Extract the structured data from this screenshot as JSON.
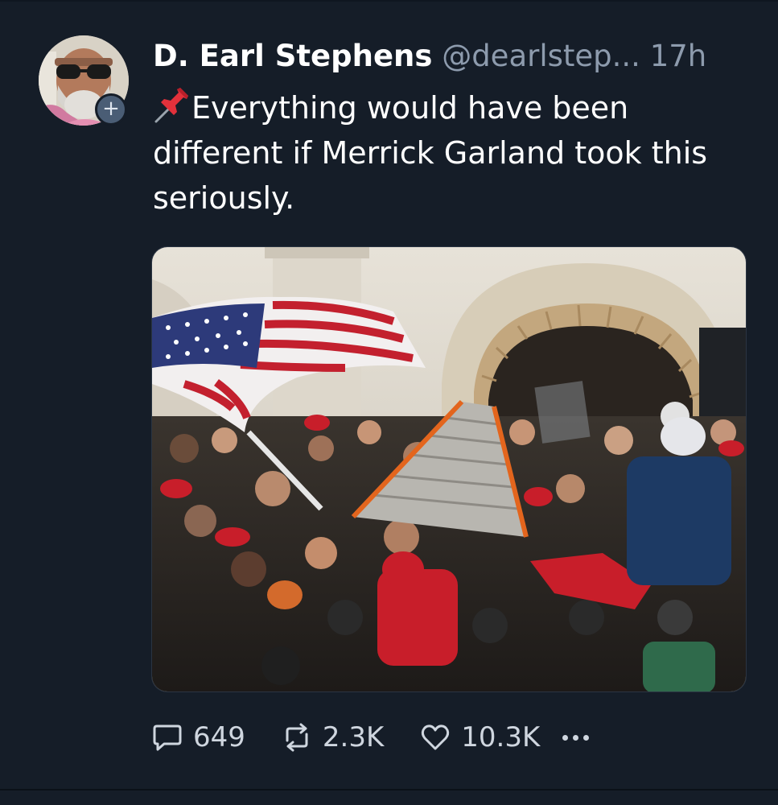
{
  "post": {
    "author_name": "D. Earl Stephens",
    "handle": "@dearlstep...",
    "separator": "",
    "timestamp": "17h",
    "text": "Everything would have been different if Merrick Garland took this seriously.",
    "pinned_icon": "pushpin-icon",
    "follow_badge": "+"
  },
  "actions": {
    "replies": "649",
    "reposts": "2.3K",
    "likes": "10.3K"
  },
  "icons": {
    "reply": "comment-bubble-icon",
    "repost": "repost-arrows-icon",
    "like": "heart-icon",
    "more": "more-horizontal-icon"
  },
  "colors": {
    "background": "#151d28",
    "secondary_text": "#8d9bad",
    "badge": "#4a5d75"
  }
}
